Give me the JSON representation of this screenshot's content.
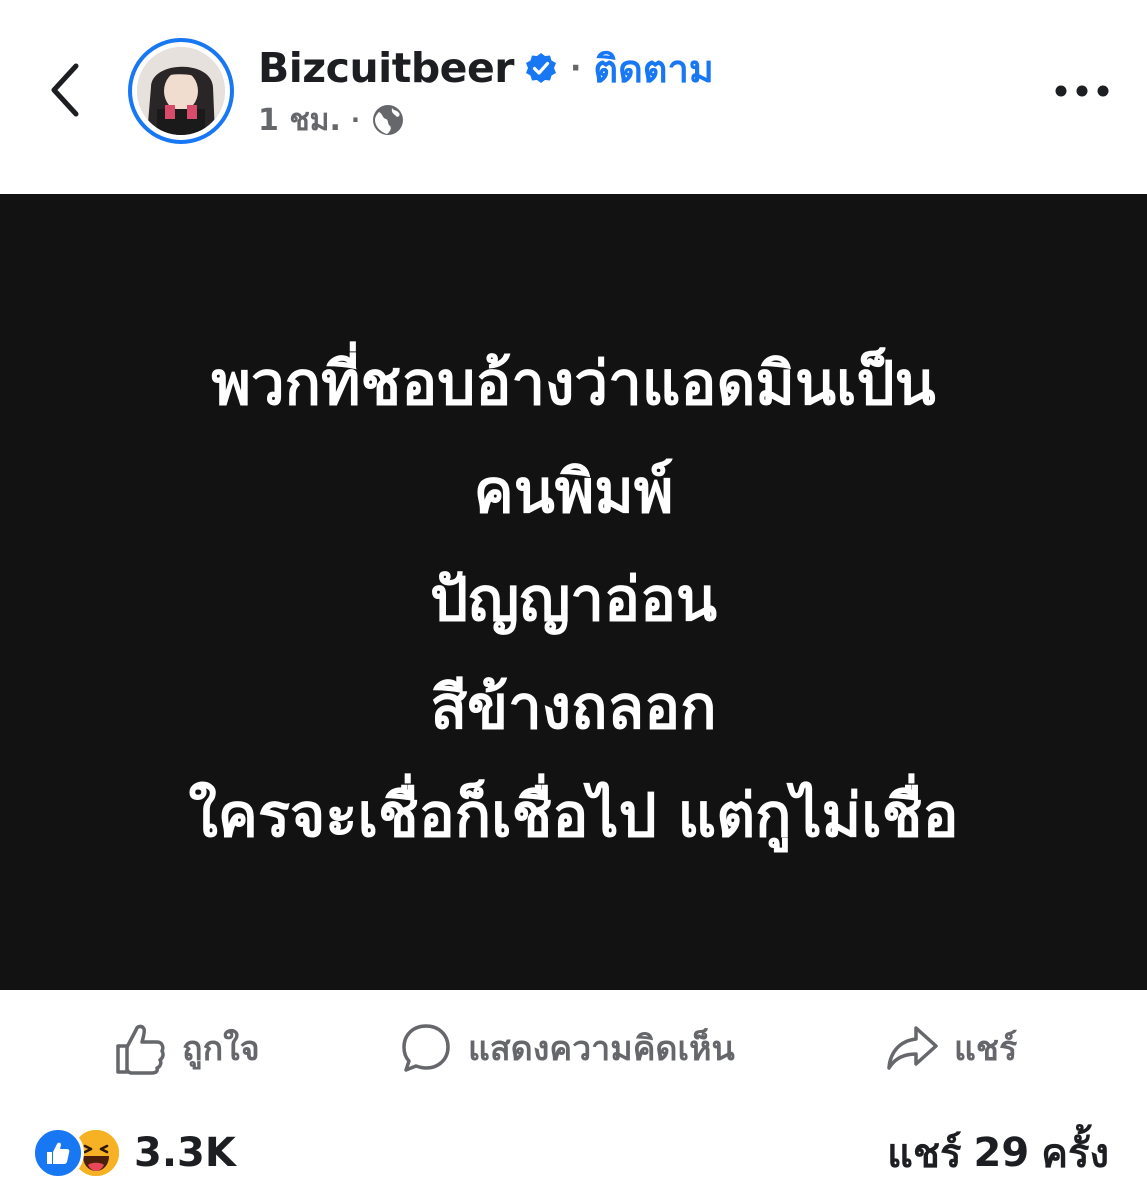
{
  "header": {
    "page_name": "Bizcuitbeer",
    "separator": "·",
    "follow_label": "ติดตาม",
    "time_ago": "1 ชม.",
    "meta_separator": "·",
    "icons": {
      "back": "chevron-left-icon",
      "verified": "verified-badge-icon",
      "privacy": "globe-icon",
      "more": "more-options-icon"
    },
    "accent_color": "#1877f2"
  },
  "post": {
    "background_color": "#121212",
    "lines": [
      "พวกที่ชอบอ้างว่าแอดมินเป็น",
      "คนพิมพ์",
      "ปัญญาอ่อน",
      "สีข้างถลอก",
      "ใครจะเชื่อก็เชื่อไป แต่กูไม่เชื่อ"
    ]
  },
  "actions": {
    "like_label": "ถูกใจ",
    "comment_label": "แสดงความคิดเห็น",
    "share_label": "แชร์",
    "icons": {
      "like": "thumbs-up-icon",
      "comment": "speech-bubble-icon",
      "share": "share-arrow-icon"
    }
  },
  "stats": {
    "reaction_count": "3.3K",
    "reaction_types": [
      "like",
      "haha"
    ],
    "share_prefix": "แชร์",
    "share_number": "29",
    "share_suffix": "ครั้ง"
  }
}
